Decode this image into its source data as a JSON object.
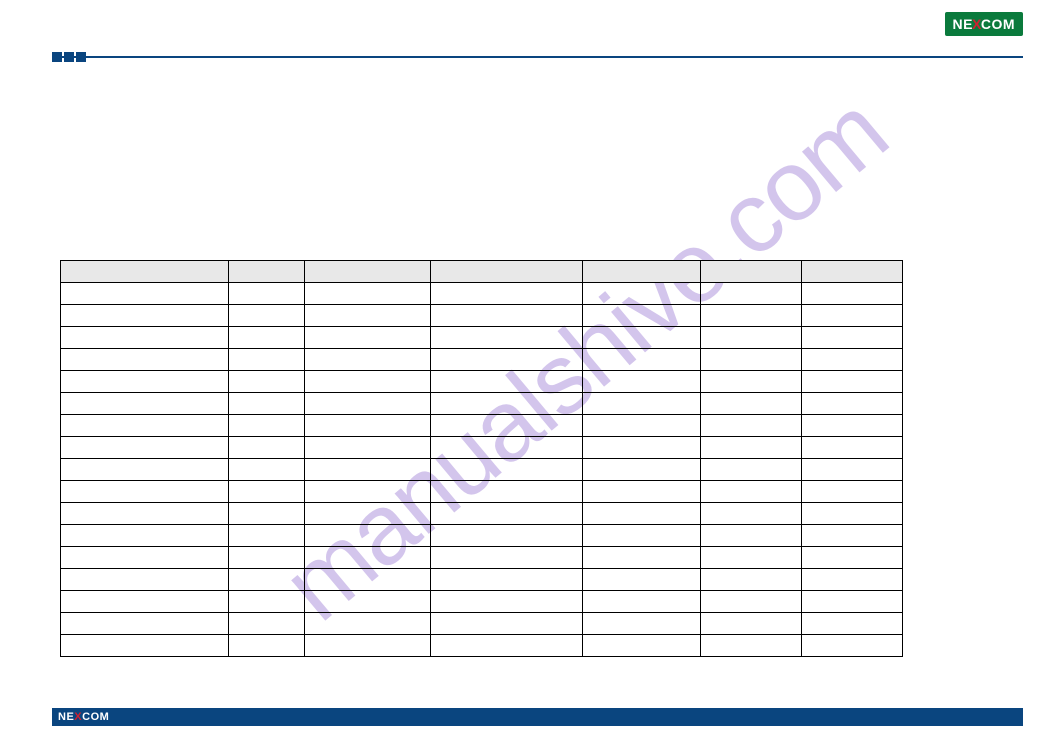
{
  "watermark": "manualshive.com",
  "brand": {
    "prefix": "NE",
    "x": "X",
    "suffix": "COM"
  },
  "table": {
    "headers": [
      "",
      "",
      "",
      "",
      "",
      "",
      ""
    ],
    "rows": [
      [
        "",
        "",
        "",
        "",
        "",
        "",
        ""
      ],
      [
        "",
        "",
        "",
        "",
        "",
        "",
        ""
      ],
      [
        "",
        "",
        "",
        "",
        "",
        "",
        ""
      ],
      [
        "",
        "",
        "",
        "",
        "",
        "",
        ""
      ],
      [
        "",
        "",
        "",
        "",
        "",
        "",
        ""
      ],
      [
        "",
        "",
        "",
        "",
        "",
        "",
        ""
      ],
      [
        "",
        "",
        "",
        "",
        "",
        "",
        ""
      ],
      [
        "",
        "",
        "",
        "",
        "",
        "",
        ""
      ],
      [
        "",
        "",
        "",
        "",
        "",
        "",
        ""
      ],
      [
        "",
        "",
        "",
        "",
        "",
        "",
        ""
      ],
      [
        "",
        "",
        "",
        "",
        "",
        "",
        ""
      ],
      [
        "",
        "",
        "",
        "",
        "",
        "",
        ""
      ],
      [
        "",
        "",
        "",
        "",
        "",
        "",
        ""
      ],
      [
        "",
        "",
        "",
        "",
        "",
        "",
        ""
      ],
      [
        "",
        "",
        "",
        "",
        "",
        "",
        ""
      ],
      [
        "",
        "",
        "",
        "",
        "",
        "",
        ""
      ],
      [
        "",
        "",
        "",
        "",
        "",
        "",
        ""
      ]
    ]
  }
}
